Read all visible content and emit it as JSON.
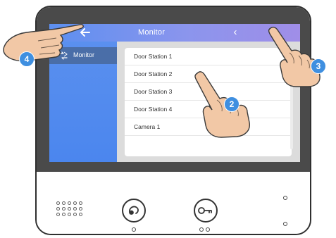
{
  "screen": {
    "title": "Monitor",
    "back_icon": "back-arrow-icon",
    "nav_icon": "chevron-left-icon"
  },
  "sidebar": {
    "items": [
      {
        "label": "Monitor",
        "icon": "monitor-icon",
        "active": true
      }
    ]
  },
  "list": {
    "items": [
      "Door Station 1",
      "Door Station 2",
      "Door Station 3",
      "Door Station 4",
      "Camera 1"
    ]
  },
  "controls": {
    "buttons": [
      {
        "icon": "talk-icon"
      },
      {
        "icon": "unlock-key-icon"
      }
    ]
  },
  "callouts": [
    {
      "number": "4",
      "target": "back-arrow-icon"
    },
    {
      "number": "2",
      "target": "list-item"
    },
    {
      "number": "3",
      "target": "chevron-left-icon"
    }
  ],
  "colors": {
    "screen_blue": "#4b86ee",
    "header_gradient_end": "#a08ee8",
    "active_item": "#4a6ea8",
    "badge": "#3f8fe0",
    "bezel": "#4a4a4a",
    "hand": "#f2c8a6"
  }
}
